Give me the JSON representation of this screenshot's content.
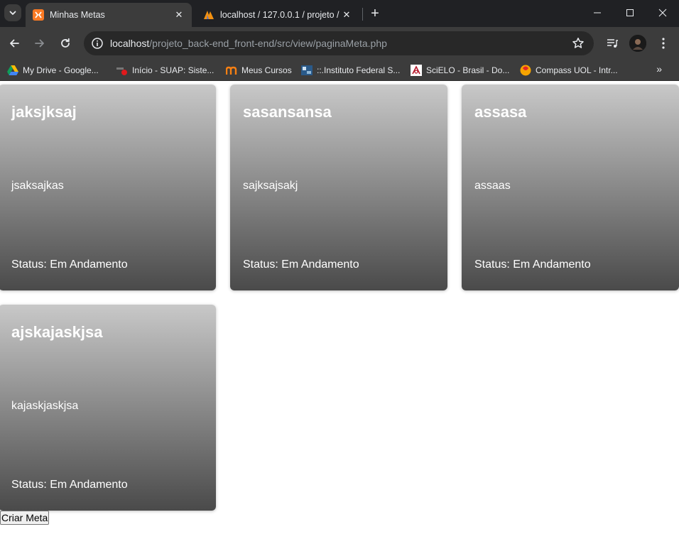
{
  "browser": {
    "tabs": [
      {
        "title": "Minhas Metas",
        "active": true,
        "favicon": "xampp-icon"
      },
      {
        "title": "localhost / 127.0.0.1 / projeto /",
        "active": false,
        "favicon": "phpmyadmin-icon"
      }
    ],
    "url": {
      "host": "localhost",
      "path": "/projeto_back-end_front-end/src/view/paginaMeta.php"
    },
    "bookmarks": [
      {
        "label": "My Drive - Google...",
        "icon": "google-drive-icon"
      },
      {
        "label": "Início - SUAP: Siste...",
        "icon": "suap-icon"
      },
      {
        "label": "Meus Cursos",
        "icon": "moodle-icon"
      },
      {
        "label": "::.Instituto Federal S...",
        "icon": "ifs-icon"
      },
      {
        "label": "SciELO - Brasil - Do...",
        "icon": "scielo-icon"
      },
      {
        "label": "Compass UOL - Intr...",
        "icon": "compass-icon"
      }
    ]
  },
  "page": {
    "cards": [
      {
        "title": "jaksjksaj",
        "description": "jsaksajkas",
        "status": "Status: Em Andamento"
      },
      {
        "title": "sasansansa",
        "description": "sajksajsakj",
        "status": "Status: Em Andamento"
      },
      {
        "title": "assasa",
        "description": "assaas",
        "status": "Status: Em Andamento"
      },
      {
        "title": "ajskajaskjsa",
        "description": "kajaskjaskjsa",
        "status": "Status: Em Andamento"
      }
    ],
    "create_button": "Criar Meta"
  }
}
